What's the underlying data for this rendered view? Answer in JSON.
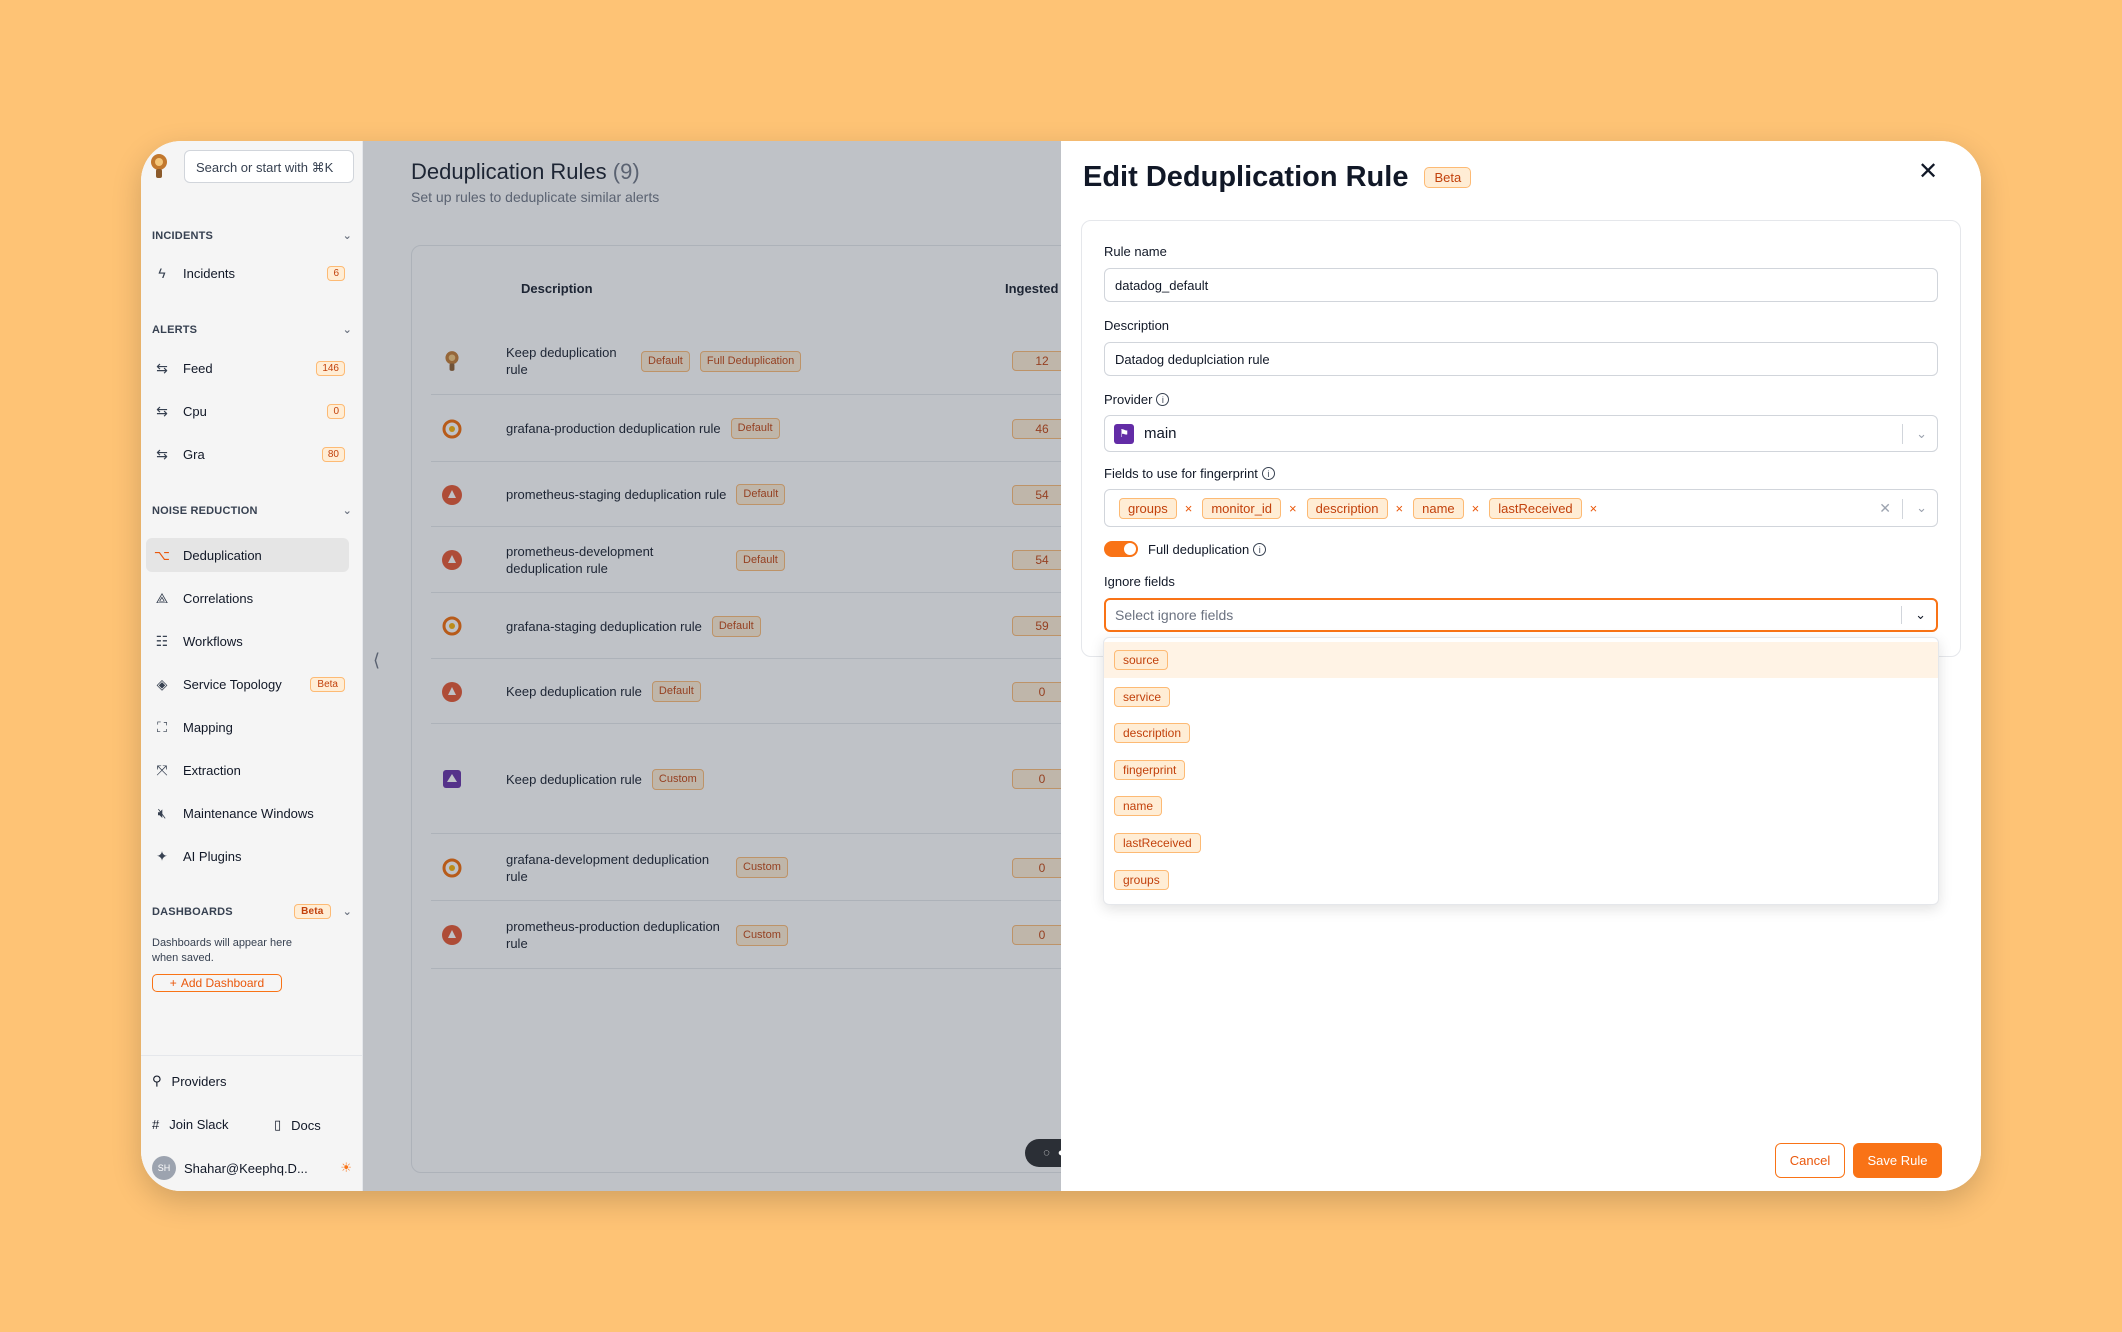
{
  "sidebar": {
    "search_placeholder": "Search or start with ⌘K",
    "sections": {
      "incidents": "INCIDENTS",
      "alerts": "ALERTS",
      "noise": "NOISE REDUCTION",
      "dashboards": "DASHBOARDS"
    },
    "incidents": {
      "label": "Incidents",
      "count": "6"
    },
    "feed": {
      "label": "Feed",
      "count": "146"
    },
    "cpu": {
      "label": "Cpu",
      "count": "0"
    },
    "gra": {
      "label": "Gra",
      "count": "80"
    },
    "noise_items": [
      "Deduplication",
      "Correlations",
      "Workflows",
      "Service Topology",
      "Mapping",
      "Extraction",
      "Maintenance Windows",
      "AI Plugins"
    ],
    "topology_badge": "Beta",
    "dashboards_badge": "Beta",
    "dashboards_note": "Dashboards will appear here when saved.",
    "add_dashboard": "Add Dashboard",
    "providers": "Providers",
    "join_slack": "Join Slack",
    "docs": "Docs",
    "user": "Shahar@Keephq.D...",
    "avatar": "SH"
  },
  "main": {
    "title": "Deduplication Rules",
    "count": "(9)",
    "subtitle": "Set up rules to deduplicate similar alerts",
    "col_description": "Description",
    "col_ingested": "Ingested",
    "rows": [
      {
        "desc": "Keep deduplication rule",
        "tags": [
          "Default",
          "Full Deduplication"
        ],
        "ingested": "12"
      },
      {
        "desc": "grafana-production deduplication rule",
        "tags": [
          "Default"
        ],
        "ingested": "46"
      },
      {
        "desc": "prometheus-staging deduplication rule",
        "tags": [
          "Default"
        ],
        "ingested": "54"
      },
      {
        "desc": "prometheus-development deduplication rule",
        "tags": [
          "Default"
        ],
        "ingested": "54"
      },
      {
        "desc": "grafana-staging deduplication rule",
        "tags": [
          "Default"
        ],
        "ingested": "59"
      },
      {
        "desc": "Keep deduplication rule",
        "tags": [
          "Default"
        ],
        "ingested": "0"
      },
      {
        "desc": "Keep deduplication rule",
        "tags": [
          "Custom"
        ],
        "ingested": "0"
      },
      {
        "desc": "grafana-development deduplication rule",
        "tags": [
          "Custom"
        ],
        "ingested": "0"
      },
      {
        "desc": "prometheus-production deduplication rule",
        "tags": [
          "Custom"
        ],
        "ingested": "0"
      }
    ]
  },
  "panel": {
    "title": "Edit Deduplication Rule",
    "badge": "Beta",
    "rule_name_label": "Rule name",
    "rule_name_value": "datadog_default",
    "description_label": "Description",
    "description_value": "Datadog deduplciation rule",
    "provider_label": "Provider",
    "provider_value": "main",
    "fields_label": "Fields to use for fingerprint",
    "fingerprint_fields": [
      "groups",
      "monitor_id",
      "description",
      "name",
      "lastReceived"
    ],
    "full_dedup_label": "Full deduplication",
    "ignore_label": "Ignore fields",
    "ignore_placeholder": "Select ignore fields",
    "ignore_options": [
      "source",
      "service",
      "description",
      "fingerprint",
      "name",
      "lastReceived",
      "groups"
    ],
    "cancel": "Cancel",
    "save": "Save Rule"
  },
  "colors": {
    "background": "#fec375",
    "accent": "#f97316",
    "badge_bg": "#ffedd5",
    "badge_text": "#c2410c"
  }
}
